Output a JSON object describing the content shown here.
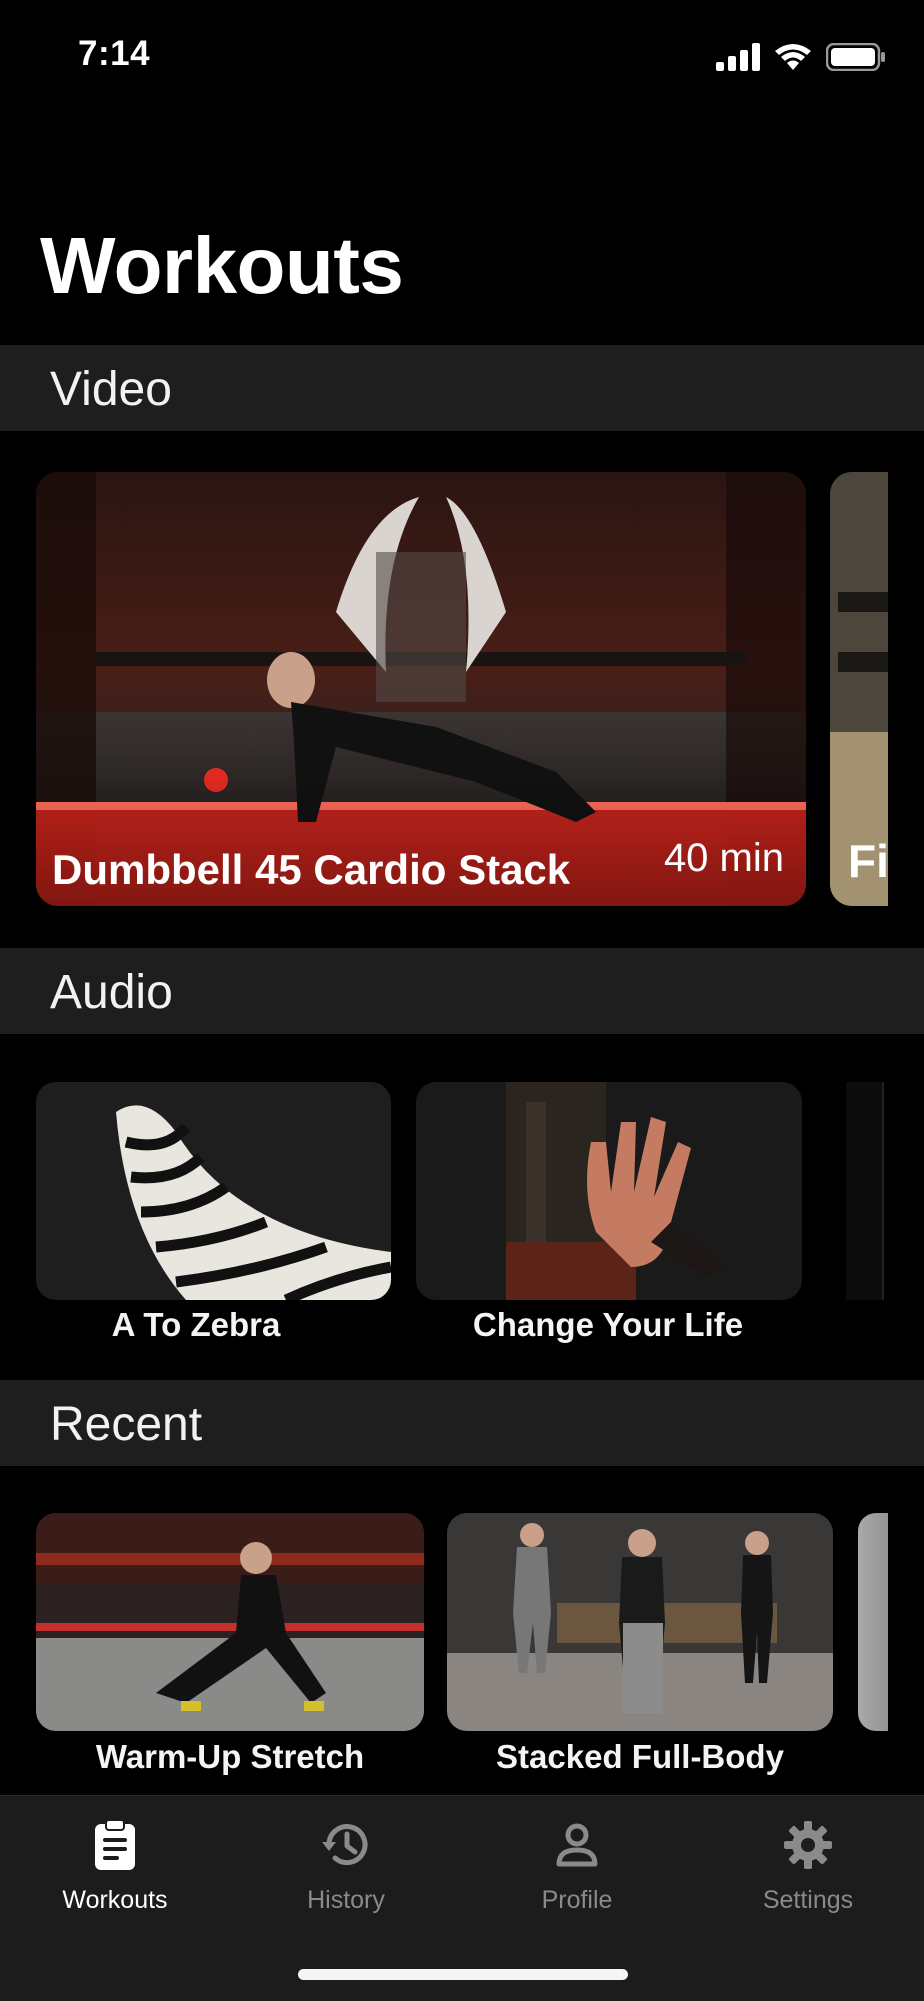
{
  "status_bar": {
    "time": "7:14"
  },
  "page": {
    "title": "Workouts"
  },
  "sections": {
    "video": {
      "header": "Video",
      "cards": [
        {
          "title": "Dumbbell 45 Cardio Stack",
          "duration": "40 min"
        },
        {
          "title": "Fi"
        }
      ]
    },
    "audio": {
      "header": "Audio",
      "items": [
        {
          "title": "A To Zebra"
        },
        {
          "title": "Change Your Life"
        }
      ]
    },
    "recent": {
      "header": "Recent",
      "items": [
        {
          "title": "Warm-Up Stretch"
        },
        {
          "title": "Stacked Full-Body"
        }
      ]
    }
  },
  "tab_bar": {
    "tabs": [
      {
        "label": "Workouts",
        "icon": "clipboard-icon",
        "active": true
      },
      {
        "label": "History",
        "icon": "history-icon",
        "active": false
      },
      {
        "label": "Profile",
        "icon": "person-icon",
        "active": false
      },
      {
        "label": "Settings",
        "icon": "gear-icon",
        "active": false
      }
    ],
    "active_color": "#ffffff",
    "inactive_color": "#8a8a8a"
  }
}
